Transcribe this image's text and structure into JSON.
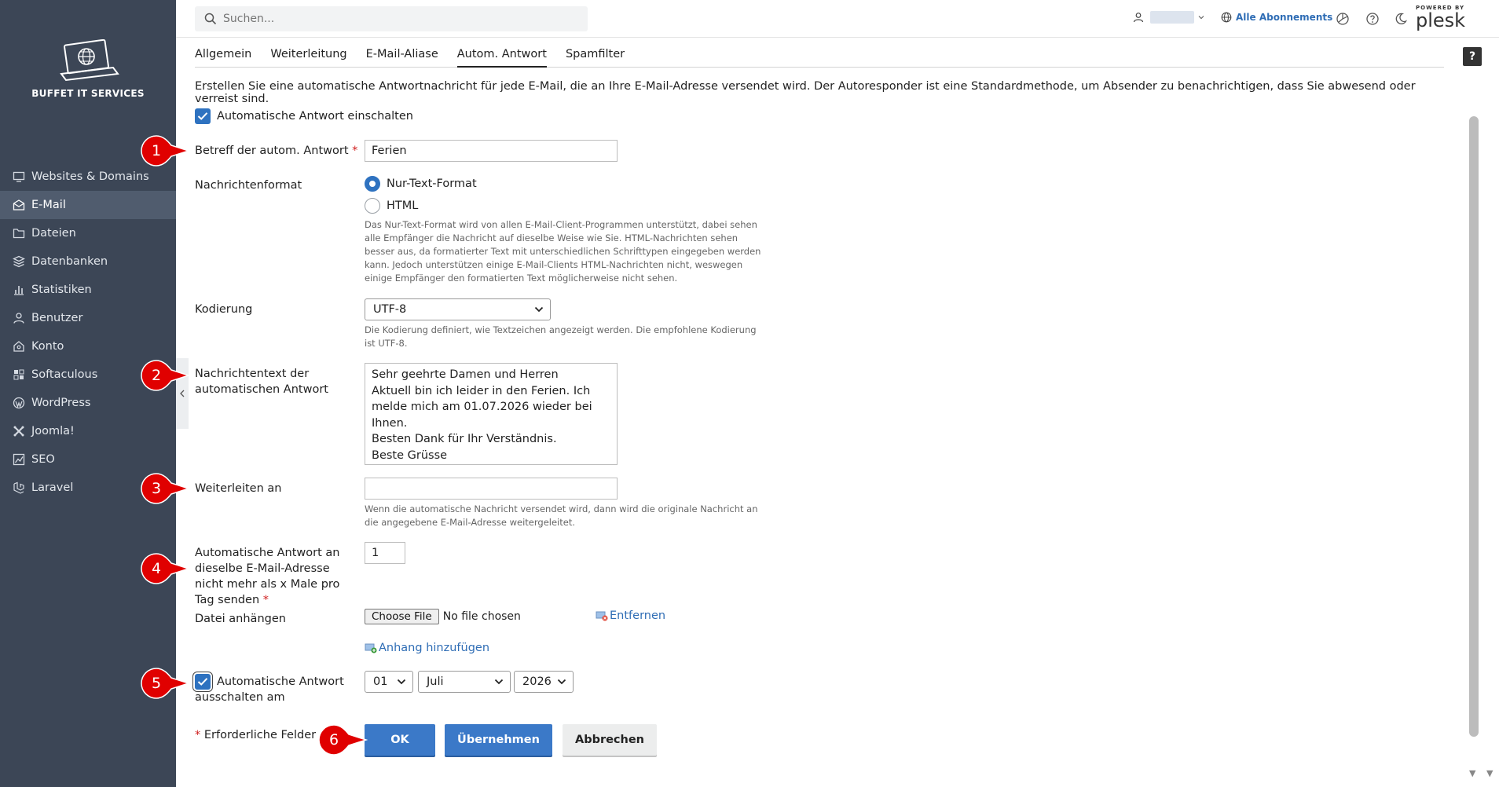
{
  "brand": {
    "name": "BUFFET IT SERVICES"
  },
  "sidebar": {
    "items": [
      {
        "label": "Websites & Domains",
        "icon": "monitor-icon",
        "active": false
      },
      {
        "label": "E-Mail",
        "icon": "mail-icon",
        "active": true
      },
      {
        "label": "Dateien",
        "icon": "folder-icon",
        "active": false
      },
      {
        "label": "Datenbanken",
        "icon": "database-icon",
        "active": false
      },
      {
        "label": "Statistiken",
        "icon": "bar-chart-icon",
        "active": false
      },
      {
        "label": "Benutzer",
        "icon": "user-icon",
        "active": false
      },
      {
        "label": "Konto",
        "icon": "account-icon",
        "active": false
      },
      {
        "label": "Softaculous",
        "icon": "softaculous-icon",
        "active": false
      },
      {
        "label": "WordPress",
        "icon": "wordpress-icon",
        "active": false
      },
      {
        "label": "Joomla!",
        "icon": "joomla-icon",
        "active": false
      },
      {
        "label": "SEO",
        "icon": "seo-icon",
        "active": false
      },
      {
        "label": "Laravel",
        "icon": "laravel-icon",
        "active": false
      }
    ]
  },
  "topbar": {
    "search_placeholder": "Suchen...",
    "subscriptions_label": "Alle Abonnements",
    "powered_by": "POWERED BY",
    "plesk": "plesk"
  },
  "help_label": "?",
  "tabs": [
    {
      "label": "Allgemein",
      "active": false
    },
    {
      "label": "Weiterleitung",
      "active": false
    },
    {
      "label": "E-Mail-Aliase",
      "active": false
    },
    {
      "label": "Autom. Antwort",
      "active": true
    },
    {
      "label": "Spamfilter",
      "active": false
    }
  ],
  "form": {
    "intro": "Erstellen Sie eine automatische Antwortnachricht für jede E-Mail, die an Ihre E-Mail-Adresse versendet wird. Der Autoresponder ist eine Standardmethode, um Absender zu benachrichtigen, dass Sie abwesend oder verreist sind.",
    "enable_label": "Automatische Antwort einschalten",
    "enable_checked": true,
    "subject_label": "Betreff der autom. Antwort",
    "required_mark": "*",
    "subject_value": "Ferien",
    "format_label": "Nachrichtenformat",
    "format_options": [
      "Nur-Text-Format",
      "HTML"
    ],
    "format_selected": "Nur-Text-Format",
    "format_hint": "Das Nur-Text-Format wird von allen E-Mail-Client-Programmen unterstützt, dabei sehen alle Empfänger die Nachricht auf dieselbe Weise wie Sie. HTML-Nachrichten sehen besser aus, da formatierter Text mit unterschiedlichen Schrifttypen eingegeben werden kann. Jedoch unterstützen einige E-Mail-Clients HTML-Nachrichten nicht, weswegen einige Empfänger den formatierten Text möglicherweise nicht sehen.",
    "encoding_label": "Kodierung",
    "encoding_value": "UTF-8",
    "encoding_hint": "Die Kodierung definiert, wie Textzeichen angezeigt werden. Die empfohlene Kodierung ist UTF-8.",
    "message_label": "Nachrichtentext der automatischen Antwort",
    "message_value": "Sehr geehrte Damen und Herren\nAktuell bin ich leider in den Ferien. Ich melde mich am 01.07.2026 wieder bei Ihnen.\nBesten Dank für Ihr Verständnis.\nBeste Grüsse\nFirma XY",
    "forward_label": "Weiterleiten an",
    "forward_value": "",
    "forward_hint": "Wenn die automatische Nachricht versendet wird, dann wird die originale Nachricht an die angegebene E-Mail-Adresse weitergeleitet.",
    "limit_label": "Automatische Antwort an dieselbe E-Mail-Adresse nicht mehr als x Male pro Tag senden",
    "limit_value": "1",
    "attach_label": "Datei anhängen",
    "choose_file_label": "Choose File",
    "no_file_label": "No file chosen",
    "remove_label": "Entfernen",
    "add_attachment_label": "Anhang hinzufügen",
    "disable_label": "Automatische Antwort ausschalten am",
    "disable_checked": true,
    "day_value": "01",
    "month_value": "Juli",
    "year_value": "2026",
    "required_fields_label": "Erforderliche Felder",
    "ok_label": "OK",
    "apply_label": "Übernehmen",
    "cancel_label": "Abbrechen"
  },
  "markers": [
    "1",
    "2",
    "3",
    "4",
    "5",
    "6"
  ],
  "colors": {
    "sidebar_bg": "#3c4656",
    "accent": "#2e72c0",
    "marker_red": "#e00000",
    "link": "#2f6db5"
  }
}
